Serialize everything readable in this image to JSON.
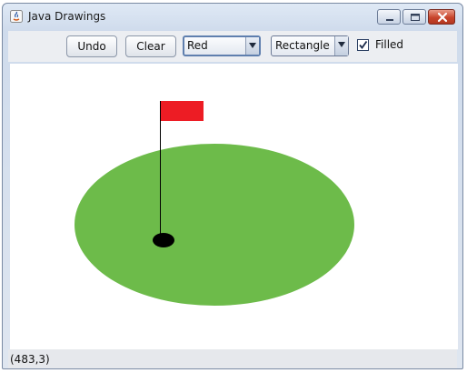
{
  "window": {
    "title": "Java Drawings"
  },
  "toolbar": {
    "undo_label": "Undo",
    "clear_label": "Clear",
    "color_select": {
      "selected": "Red"
    },
    "shape_select": {
      "selected": "Rectangle"
    },
    "filled_checkbox": {
      "label": "Filled",
      "checked": true
    }
  },
  "drawing": {
    "shapes": [
      {
        "kind": "filled-oval",
        "color": "#6dbb4a"
      },
      {
        "kind": "filled-rectangle",
        "color": "#ed1c24"
      },
      {
        "kind": "line",
        "color": "#000000"
      },
      {
        "kind": "filled-oval",
        "color": "#000000"
      }
    ]
  },
  "status": {
    "coordinates": "(483,3)"
  },
  "colors": {
    "green": "#6dbb4a",
    "red": "#ed1c24",
    "black": "#000000"
  }
}
